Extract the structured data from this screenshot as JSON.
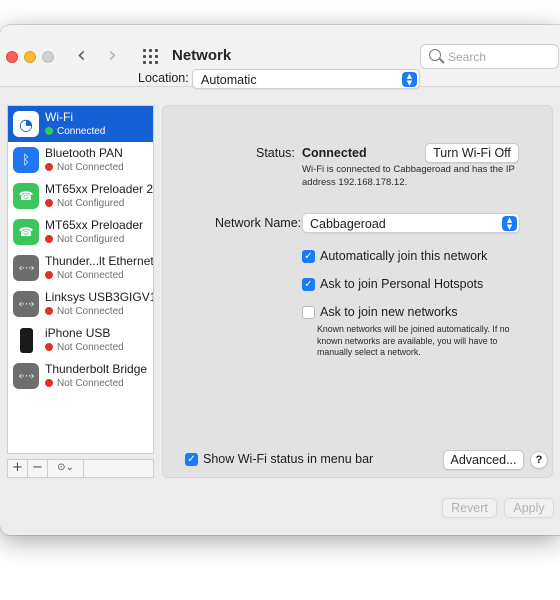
{
  "window": {
    "title": "Network"
  },
  "toolbar": {
    "search_placeholder": "Search"
  },
  "location": {
    "label": "Location:",
    "value": "Automatic"
  },
  "services": [
    {
      "name": "Wi-Fi",
      "status": "Connected",
      "status_color": "green",
      "icon": "wifi-icon",
      "selected": true
    },
    {
      "name": "Bluetooth PAN",
      "status": "Not Connected",
      "status_color": "red",
      "icon": "bluetooth-icon"
    },
    {
      "name": "MT65xx Preloader 2",
      "status": "Not Configured",
      "status_color": "red",
      "icon": "phone-connection-icon"
    },
    {
      "name": "MT65xx Preloader",
      "status": "Not Configured",
      "status_color": "red",
      "icon": "phone-connection-icon"
    },
    {
      "name": "Thunder...lt Ethernet",
      "status": "Not Connected",
      "status_color": "red",
      "icon": "ethernet-icon"
    },
    {
      "name": "Linksys USB3GIGV1",
      "status": "Not Connected",
      "status_color": "red",
      "icon": "ethernet-icon"
    },
    {
      "name": "iPhone USB",
      "status": "Not Connected",
      "status_color": "red",
      "icon": "iphone-icon"
    },
    {
      "name": "Thunderbolt Bridge",
      "status": "Not Connected",
      "status_color": "red",
      "icon": "ethernet-icon"
    }
  ],
  "sidebar_tools": {
    "add": "+",
    "remove": "−",
    "action": "⊙⌄"
  },
  "detail": {
    "status_label": "Status:",
    "status_value": "Connected",
    "turn_off_button": "Turn Wi-Fi Off",
    "status_description": "Wi-Fi is connected to Cabbageroad and has the IP address 192.168.178.12.",
    "network_name_label": "Network Name:",
    "network_name_value": "Cabbageroad",
    "auto_join": {
      "label": "Automatically join this network",
      "checked": true
    },
    "ask_hotspots": {
      "label": "Ask to join Personal Hotspots",
      "checked": true
    },
    "ask_new": {
      "label": "Ask to join new networks",
      "checked": false
    },
    "known_networks_note": "Known networks will be joined automatically. If no known networks are available, you will have to manually select a network.",
    "show_in_menu_bar": {
      "label": "Show Wi-Fi status in menu bar",
      "checked": true
    },
    "advanced_button": "Advanced...",
    "help_button": "?"
  },
  "footer": {
    "revert_button": "Revert",
    "apply_button": "Apply"
  },
  "colors": {
    "accent": "#1a7cf5",
    "selection": "#1660d6",
    "status_green": "#35c759",
    "status_red": "#e0312b"
  }
}
